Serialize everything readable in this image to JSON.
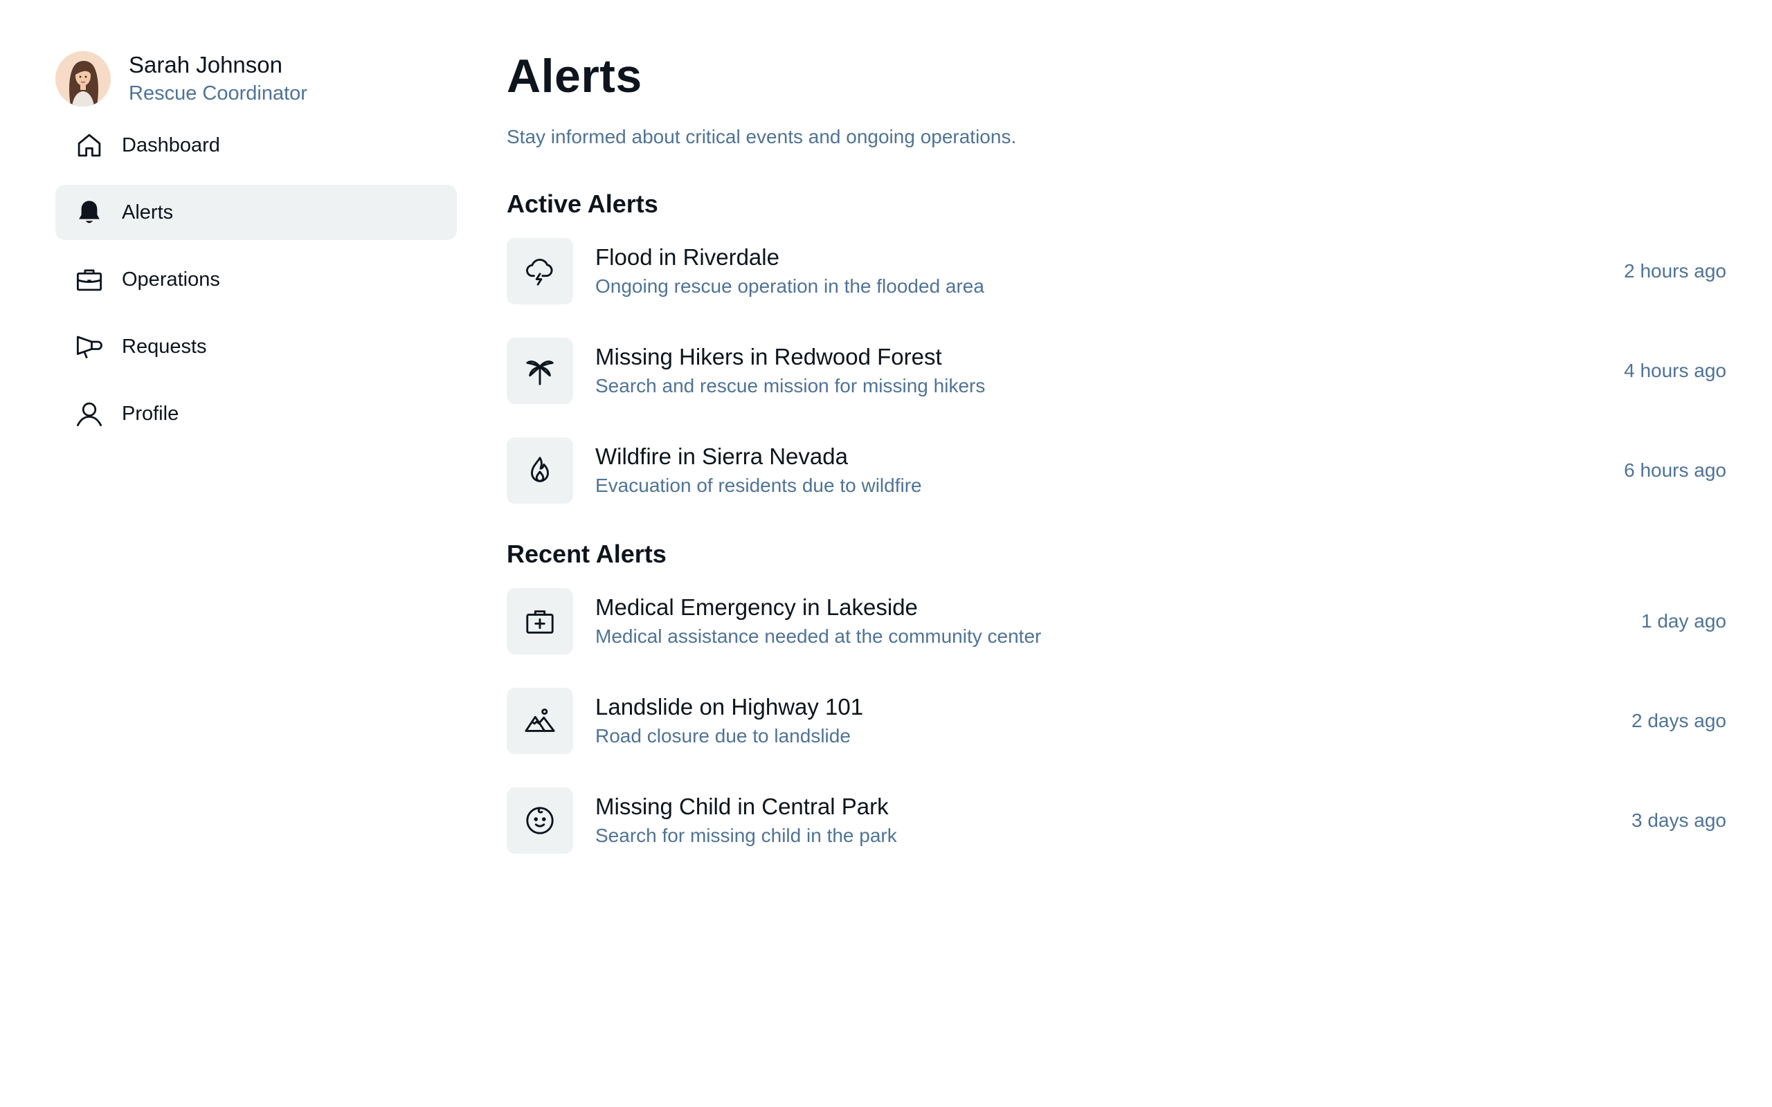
{
  "user": {
    "name": "Sarah Johnson",
    "role": "Rescue Coordinator"
  },
  "nav": {
    "items": [
      {
        "label": "Dashboard",
        "icon": "house-icon"
      },
      {
        "label": "Alerts",
        "icon": "bell-icon",
        "active": true
      },
      {
        "label": "Operations",
        "icon": "briefcase-icon"
      },
      {
        "label": "Requests",
        "icon": "megaphone-icon"
      },
      {
        "label": "Profile",
        "icon": "user-icon"
      }
    ]
  },
  "page": {
    "title": "Alerts",
    "subtitle": "Stay informed about critical events and ongoing operations."
  },
  "active_alerts": {
    "heading": "Active Alerts",
    "items": [
      {
        "title": "Flood in Riverdale",
        "description": "Ongoing rescue operation in the flooded area",
        "time": "2 hours ago",
        "icon": "cloud-lightning-icon"
      },
      {
        "title": "Missing Hikers in Redwood Forest",
        "description": "Search and rescue mission for missing hikers",
        "time": "4 hours ago",
        "icon": "palm-tree-icon"
      },
      {
        "title": "Wildfire in Sierra Nevada",
        "description": "Evacuation of residents due to wildfire",
        "time": "6 hours ago",
        "icon": "flame-icon"
      }
    ]
  },
  "recent_alerts": {
    "heading": "Recent Alerts",
    "items": [
      {
        "title": "Medical Emergency in Lakeside",
        "description": "Medical assistance needed at the community center",
        "time": "1 day ago",
        "icon": "first-aid-kit-icon"
      },
      {
        "title": "Landslide on Highway 101",
        "description": "Road closure due to landslide",
        "time": "2 days ago",
        "icon": "mountains-icon"
      },
      {
        "title": "Missing Child in Central Park",
        "description": "Search for missing child in the park",
        "time": "3 days ago",
        "icon": "baby-face-icon"
      }
    ]
  },
  "colors": {
    "text_primary": "#0d141c",
    "text_secondary": "#4f7396",
    "surface": "#eef2f3",
    "background": "#ffffff"
  }
}
